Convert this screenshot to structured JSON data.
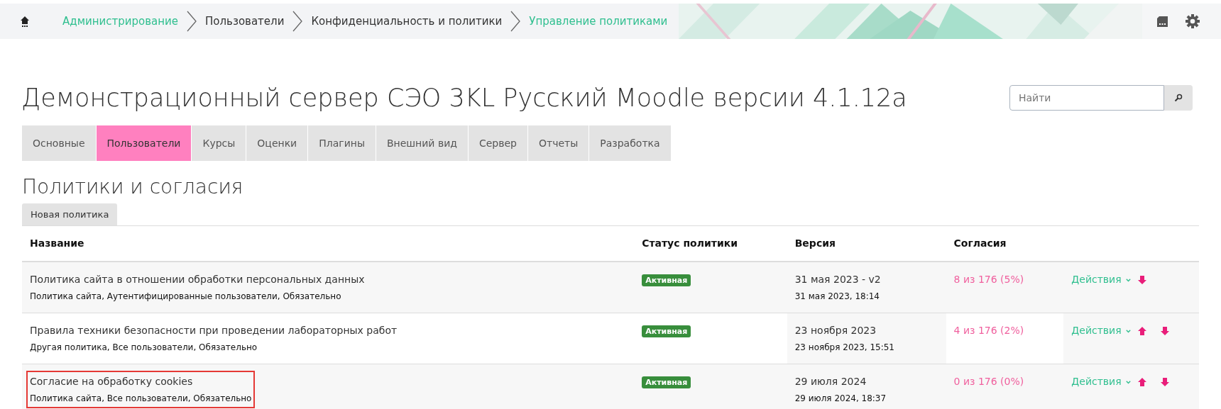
{
  "breadcrumb": [
    {
      "label": "Администрирование",
      "link": true
    },
    {
      "label": "Пользователи",
      "link": false
    },
    {
      "label": "Конфиденциальность и политики",
      "link": false
    },
    {
      "label": "Управление политиками",
      "link": true
    }
  ],
  "site_title": "Демонстрационный сервер СЭО 3KL Русский Moodle версии 4.1.12a",
  "search": {
    "placeholder": "Найти"
  },
  "tabs": [
    {
      "label": "Основные",
      "selected": false
    },
    {
      "label": "Пользователи",
      "selected": true
    },
    {
      "label": "Курсы",
      "selected": false
    },
    {
      "label": "Оценки",
      "selected": false
    },
    {
      "label": "Плагины",
      "selected": false
    },
    {
      "label": "Внешний вид",
      "selected": false
    },
    {
      "label": "Сервер",
      "selected": false
    },
    {
      "label": "Отчеты",
      "selected": false
    },
    {
      "label": "Разработка",
      "selected": false
    }
  ],
  "page_heading": "Политики и согласия",
  "new_button": "Новая политика",
  "table": {
    "columns": [
      "Название",
      "Статус политики",
      "Версия",
      "Согласия"
    ],
    "rows": [
      {
        "name": "Политика сайта в отношении обработки персональных данных",
        "details": "Политика сайта, Аутентифицированные пользователи, Обязательно",
        "status": "Активная",
        "version": "31 мая 2023 - v2",
        "date": "31 мая 2023, 18:14",
        "consents": "8 из 176 (5%)",
        "actions": "Действия",
        "can_move_up": false,
        "can_move_down": true,
        "highlighted": false
      },
      {
        "name": "Правила техники безопасности при проведении лабораторных работ",
        "details": "Другая политика, Все пользователи, Обязательно",
        "status": "Активная",
        "version": "23 ноября 2023",
        "date": "23 ноября 2023, 15:51",
        "consents": "4 из 176 (2%)",
        "actions": "Действия",
        "can_move_up": true,
        "can_move_down": true,
        "highlighted": false
      },
      {
        "name": "Согласие на обработку cookies",
        "details": "Политика сайта, Все пользователи, Обязательно",
        "status": "Активная",
        "version": "29 июля 2024",
        "date": "29 июля 2024, 18:37",
        "consents": "0 из 176 (0%)",
        "actions": "Действия",
        "can_move_up": true,
        "can_move_down": true,
        "highlighted": true
      }
    ]
  }
}
